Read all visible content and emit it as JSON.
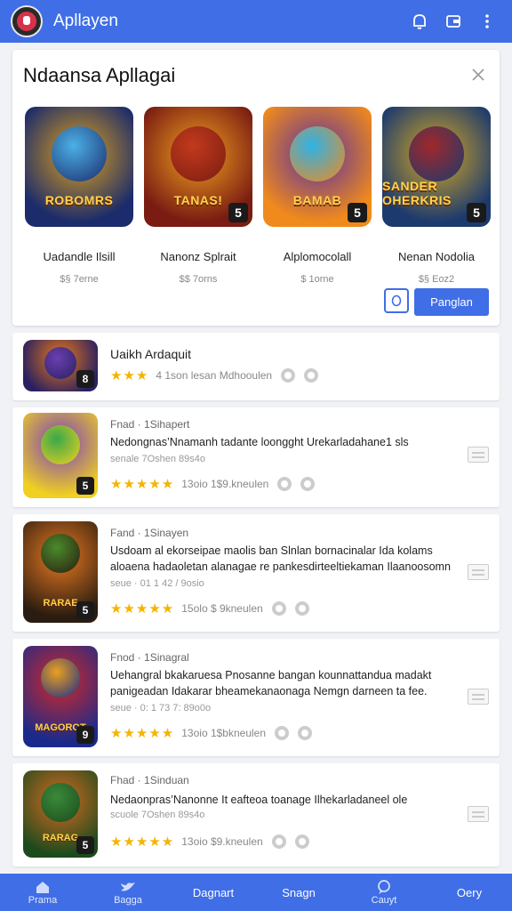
{
  "header": {
    "app_title": "Apllayen"
  },
  "featured": {
    "title": "Ndaansa Apllagai",
    "games": [
      {
        "name": "Uadandle Ilsill",
        "sub": "$§ 7erne",
        "art_text": "ROBOMRS",
        "badge": "",
        "colors": [
          "#1b2b6b",
          "#e0a21a",
          "#4bb0e6"
        ]
      },
      {
        "name": "Nanonz Splrait",
        "sub": "$$ 7orns",
        "art_text": "TANAS!",
        "badge": "5",
        "colors": [
          "#7a1c12",
          "#f0a020",
          "#c23a1c"
        ]
      },
      {
        "name": "Alplomocolall",
        "sub": "$ 1orne",
        "art_text": "BAMAB",
        "badge": "5",
        "colors": [
          "#f08a1c",
          "#5a2fa0",
          "#2fb2e8"
        ]
      },
      {
        "name": "Nenan Nodolia",
        "sub": "$§ Eoz2",
        "art_text": "SANDER OHERKRIS",
        "badge": "5",
        "colors": [
          "#1c3a6e",
          "#d8a822",
          "#a0282a"
        ]
      }
    ],
    "primary_button": "Panglan"
  },
  "list": [
    {
      "title": "Uaikh Ardaquit",
      "stars": "★★★",
      "rating_text": "4  1son lesan Mdhooulen",
      "thumb_text": "",
      "badge": "8",
      "colors": [
        "#2a2060",
        "#e8781a",
        "#6a3fb0"
      ]
    },
    {
      "meta": "Fnad  ·  1Sihapert",
      "title": "Nedongnas’Nnamanh  tadante loongght Urekarladahane1 sls",
      "sub": "senale  7Oshen  89s4o",
      "stars": "★★★★★",
      "rating_text": "13oio 1$9.kneulen",
      "thumb_text": "",
      "badge": "5",
      "colors": [
        "#f0d020",
        "#7a3fc0",
        "#3aa84a"
      ]
    },
    {
      "meta": "Fand  ·  1Sinayen",
      "title": "Usdoam  al ekorseipae maolis  ban Slnlan bornacinalar Ida kolams",
      "title2": "aloaena hadaoletan alanagae re pankesdirteeltiekaman Ilaanoosomn",
      "sub": "seue  ·  01  1 42 /  9osio",
      "stars": "★★★★★",
      "rating_text": "15olo  $ 9kneulen",
      "thumb_text": "RARAE",
      "badge": "5",
      "colors": [
        "#2a1c10",
        "#e87820",
        "#4a8a2a"
      ]
    },
    {
      "meta": "Fnod  ·  1Sinagral",
      "title": "Uehangral bkakaruesa  Pnosanne bangan kounnattandua madakt",
      "title2": "panigeadan Idakarar bheamekanaonaga Nemgn darneen ta fee.",
      "sub": "seue  ·  0:  1 73 7:  89o0o",
      "stars": "★★★★★",
      "rating_text": "13oio 1$bkneulen",
      "thumb_text": "MAGOROT",
      "badge": "9",
      "colors": [
        "#1a2a8a",
        "#d02828",
        "#e8a020"
      ]
    },
    {
      "meta": "Fhad  ·  1Sinduan",
      "title": "Nedaonpras’Nanonne It eafteoa toanage  Ilhekarladaneel ole",
      "sub": "scuole  7Oshen  89s4o",
      "stars": "★★★★★",
      "rating_text": "13oio  $9.kneulen",
      "thumb_text": "RARAG",
      "badge": "5",
      "colors": [
        "#1c4a1c",
        "#d86a20",
        "#3a8a3a"
      ]
    }
  ],
  "bottom_nav": [
    {
      "label": "Prama",
      "icon": "home-icon"
    },
    {
      "label": "Bagga",
      "icon": "bird-icon"
    },
    {
      "label": "Dagnart",
      "icon": ""
    },
    {
      "label": "Snagn",
      "icon": ""
    },
    {
      "label": "Cauyt",
      "icon": "chat-icon"
    },
    {
      "label": "Oery",
      "icon": ""
    }
  ],
  "theme": {
    "accent": "#3f6ee6",
    "star": "#f4b400"
  }
}
